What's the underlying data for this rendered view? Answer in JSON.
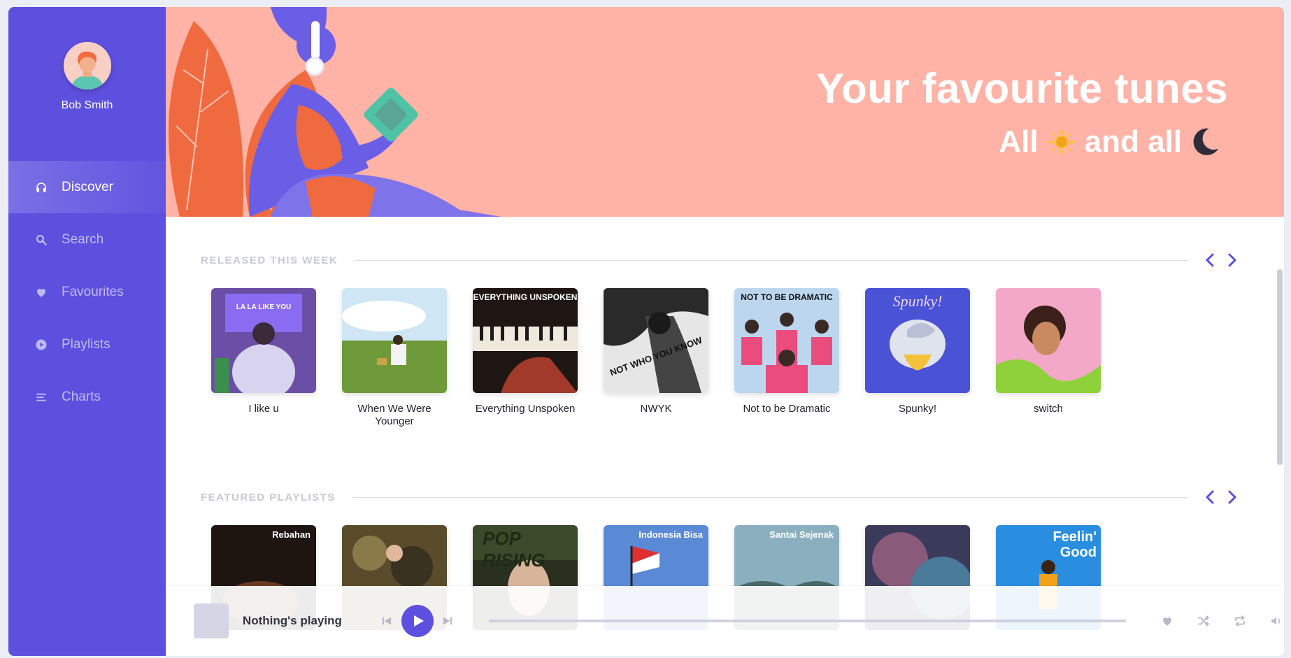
{
  "user": {
    "name": "Bob Smith"
  },
  "nav": [
    {
      "label": "Discover",
      "icon": "headphones-icon",
      "active": true
    },
    {
      "label": "Search",
      "icon": "search-icon",
      "active": false
    },
    {
      "label": "Favourites",
      "icon": "heart-icon",
      "active": false
    },
    {
      "label": "Playlists",
      "icon": "play-circle-icon",
      "active": false
    },
    {
      "label": "Charts",
      "icon": "list-icon",
      "active": false
    }
  ],
  "hero": {
    "title": "Your favourite tunes",
    "subtitle_part1": "All",
    "subtitle_part2": "and all",
    "background": "#ffb3a6"
  },
  "sections": {
    "released": {
      "title": "RELEASED THIS WEEK",
      "items": [
        {
          "title": "I like u",
          "cover_text": "LA LA LIKE YOU"
        },
        {
          "title": "When We Were Younger",
          "cover_text": ""
        },
        {
          "title": "Everything Unspoken",
          "cover_text": "EVERYTHING UNSPOKEN"
        },
        {
          "title": "NWYK",
          "cover_text": "NOT WHO YOU KNOW"
        },
        {
          "title": "Not to be Dramatic",
          "cover_text": "NOT TO BE DRAMATIC"
        },
        {
          "title": "Spunky!",
          "cover_text": "Spunky!"
        },
        {
          "title": "switch",
          "cover_text": ""
        }
      ]
    },
    "featured": {
      "title": "FEATURED PLAYLISTS",
      "items": [
        {
          "cover_text": "Rebahan"
        },
        {
          "cover_text": ""
        },
        {
          "cover_text": "POP RISING"
        },
        {
          "cover_text": "Indonesia Bisa"
        },
        {
          "cover_text": "Santai Sejenak"
        },
        {
          "cover_text": ""
        },
        {
          "cover_text": "Feelin' Good"
        }
      ]
    }
  },
  "player": {
    "now_playing": "Nothing's playing",
    "progress": 0
  },
  "colors": {
    "accent": "#5d50df",
    "hero": "#ffb3a6",
    "sidebar": "#5d50df"
  }
}
